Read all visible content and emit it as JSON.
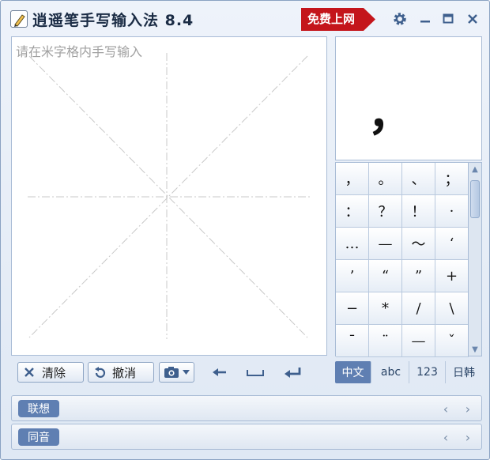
{
  "window": {
    "title": "逍遥笔手写输入法 8.4",
    "free_button": "免费上网",
    "controls": {
      "settings": "⚙",
      "minimize": "−",
      "maximize": "□",
      "close": "✕"
    }
  },
  "pad": {
    "placeholder": "请在米字格内手写输入",
    "toolbar": {
      "clear_label": "清除",
      "undo_label": "撤消"
    }
  },
  "preview": {
    "char": "，"
  },
  "symbols": {
    "rows": [
      [
        "，",
        "。",
        "、",
        "；"
      ],
      [
        "：",
        "？",
        "！",
        "·"
      ],
      [
        "…",
        "—",
        "～",
        "‘"
      ],
      [
        "’",
        "“",
        "”",
        "+"
      ],
      [
        "−",
        "*",
        "/",
        "\\"
      ],
      [
        "¯",
        "¨",
        "—",
        "ˇ"
      ]
    ]
  },
  "lang_tabs": [
    {
      "label": "中文",
      "active": true
    },
    {
      "label": "abc",
      "active": false
    },
    {
      "label": "123",
      "active": false
    },
    {
      "label": "日韩",
      "active": false
    }
  ],
  "bars": {
    "association": "联想",
    "homophone": "同音"
  },
  "colors": {
    "accent": "#5f7fb2",
    "free_button": "#c4151b"
  }
}
